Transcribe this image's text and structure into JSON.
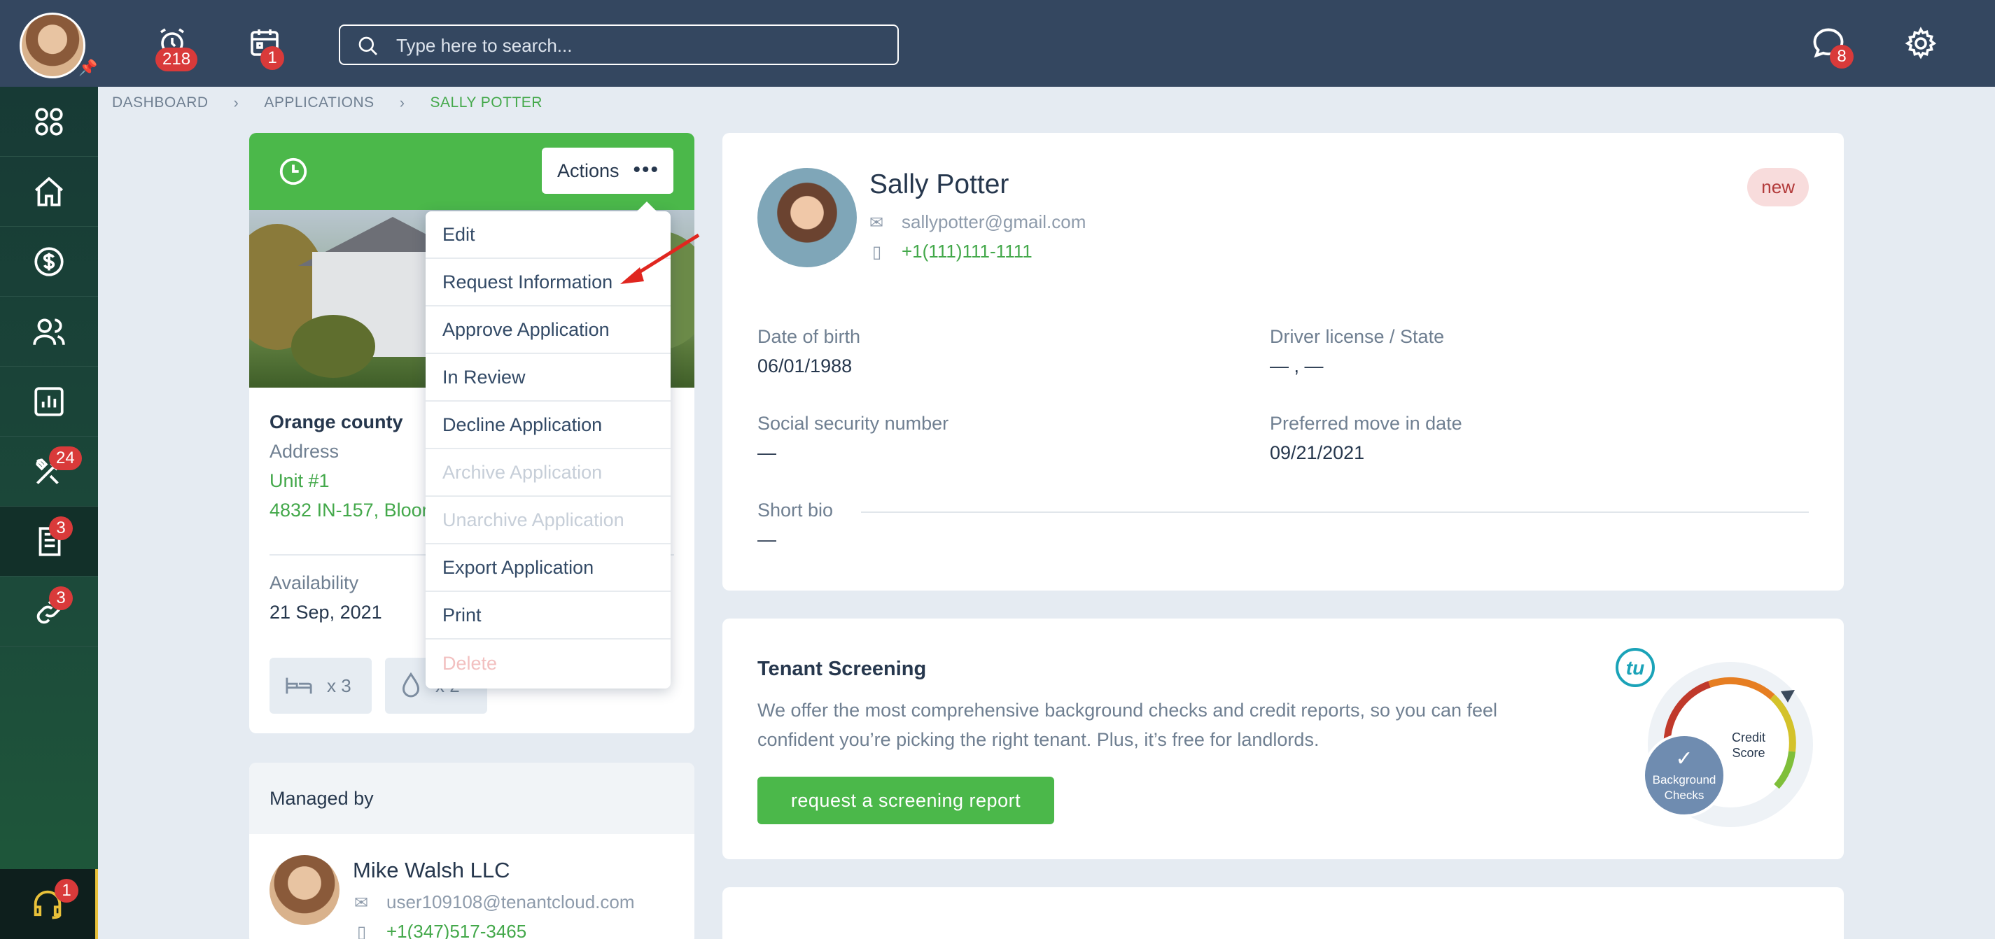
{
  "header": {
    "alerts_badge": "218",
    "calendar_badge": "1",
    "messages_badge": "8",
    "search": {
      "placeholder": "Type here to search..."
    }
  },
  "sidebar": {
    "items": [
      {
        "name": "apps",
        "badge": ""
      },
      {
        "name": "home",
        "badge": ""
      },
      {
        "name": "accounting",
        "badge": ""
      },
      {
        "name": "people",
        "badge": ""
      },
      {
        "name": "reports",
        "badge": ""
      },
      {
        "name": "maintenance",
        "badge": "24"
      },
      {
        "name": "applications",
        "badge": "3"
      },
      {
        "name": "links",
        "badge": "3"
      }
    ],
    "help_badge": "1"
  },
  "breadcrumb": {
    "items": [
      "DASHBOARD",
      "APPLICATIONS"
    ],
    "current": "SALLY POTTER"
  },
  "property": {
    "actions_label": "Actions",
    "county": "Orange county",
    "address_label": "Address",
    "unit": "Unit #1",
    "street": "4832 IN-157, Bloomfield",
    "availability_label": "Availability",
    "availability_value": "21 Sep, 2021",
    "beds": "x 3",
    "baths": "x 2"
  },
  "actions_menu": {
    "items": [
      {
        "label": "Edit",
        "state": "enabled"
      },
      {
        "label": "Request Information",
        "state": "enabled"
      },
      {
        "label": "Approve Application",
        "state": "enabled"
      },
      {
        "label": "In Review",
        "state": "enabled"
      },
      {
        "label": "Decline Application",
        "state": "enabled"
      },
      {
        "label": "Archive Application",
        "state": "disabled"
      },
      {
        "label": "Unarchive Application",
        "state": "disabled"
      },
      {
        "label": "Export Application",
        "state": "enabled"
      },
      {
        "label": "Print",
        "state": "enabled"
      },
      {
        "label": "Delete",
        "state": "disabled"
      }
    ]
  },
  "managed_by": {
    "title": "Managed by",
    "name": "Mike Walsh LLC",
    "email": "user109108@tenantcloud.com",
    "phone": "+1(347)517-3465"
  },
  "applicant": {
    "name": "Sally Potter",
    "email": "sallypotter@gmail.com",
    "phone": "+1(111)111-1111",
    "status": "new",
    "dob_label": "Date of birth",
    "dob_value": "06/01/1988",
    "license_label": "Driver license / State",
    "license_value": "— , —",
    "ssn_label": "Social security number",
    "ssn_value": "—",
    "move_label": "Preferred move in date",
    "move_value": "09/21/2021",
    "bio_label": "Short bio",
    "bio_value": "—"
  },
  "screening": {
    "title": "Tenant Screening",
    "description": "We offer the most comprehensive background checks and credit reports, so you can feel confident you’re picking the right tenant. Plus, it’s free for landlords.",
    "button_label": "request a screening report",
    "logo_text": "tu",
    "gauge_label_1": "Credit",
    "gauge_label_2": "Score",
    "check_label_1": "Background",
    "check_label_2": "Checks"
  },
  "colors": {
    "topbar": "#344760",
    "accent_green": "#4bb84a",
    "badge_red": "#d93a3a"
  }
}
